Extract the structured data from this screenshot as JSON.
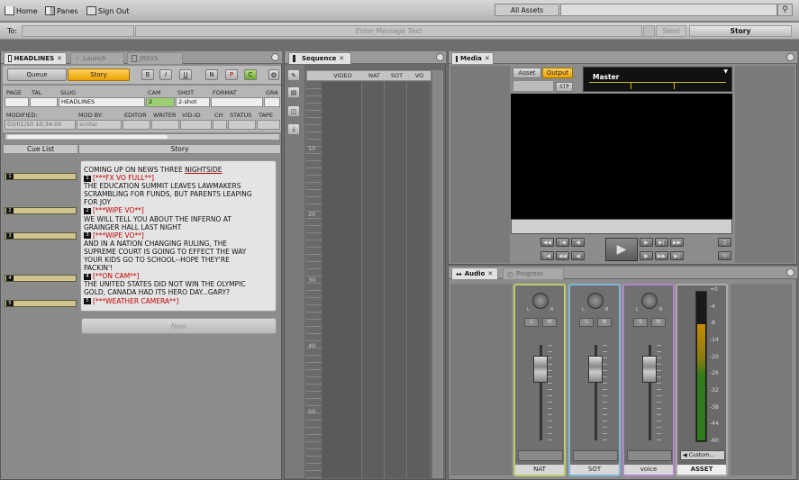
{
  "toolbar": {
    "home_label": "Home",
    "panes_label": "Panes",
    "signout_label": "Sign Out",
    "search_scope": "All Assets"
  },
  "message_bar": {
    "to_label": "To:",
    "placeholder": "Enter Message Text",
    "send_label": "Send",
    "target_value": "Story"
  },
  "left_panel": {
    "tabs": [
      {
        "label": "HEADLINES",
        "active": true
      },
      {
        "label": "Launch",
        "active": false
      },
      {
        "label": "JRSV1",
        "active": false
      }
    ],
    "mode_buttons": {
      "queue": "Queue",
      "story": "Story"
    },
    "format_buttons": [
      "B",
      "I",
      "U",
      "N",
      "P",
      "C"
    ],
    "header_labels": [
      "PAGE",
      "TAL",
      "SLUG",
      "CAM",
      "SHOT",
      "FORMAT",
      "GRA"
    ],
    "values": {
      "slug": "HEADLINES",
      "cam": "2",
      "shot": "2-shot"
    },
    "meta_labels": [
      "MODIFIED:",
      "MOD BY:",
      "EDITOR",
      "WRITER",
      "VID-ID",
      "CH",
      "STATUS",
      "TAPE"
    ],
    "meta_values": {
      "modified": "03/01/10 10:34:05",
      "mod_by": "avstar"
    },
    "columns": {
      "cue_list": "Cue List",
      "story": "Story"
    },
    "cue_numbers": [
      "1",
      "2",
      "3",
      "4",
      "5"
    ],
    "story_lines": [
      {
        "text": "COMING UP ON NEWS THREE ",
        "suffix": "NIGHTSIDE",
        "red": false,
        "num": ""
      },
      {
        "text": "[***FX VO FULL**]",
        "red": true,
        "num": "1"
      },
      {
        "text": "THE EDUCATION SUMMIT LEAVES LAWMAKERS",
        "red": false,
        "num": ""
      },
      {
        "text": "SCRAMBLING FOR FUNDS, BUT PARENTS LEAPING",
        "red": false,
        "num": ""
      },
      {
        "text": "FOR JOY",
        "red": false,
        "num": ""
      },
      {
        "text": "[***WIPE VO**]",
        "red": true,
        "num": "2"
      },
      {
        "text": "WE WILL TELL YOU ABOUT THE INFERNO AT",
        "red": false,
        "num": ""
      },
      {
        "text": "GRAINGER HALL LAST NIGHT",
        "red": false,
        "num": ""
      },
      {
        "text": "[***WIPE VO**]",
        "red": true,
        "num": "3"
      },
      {
        "text": "AND IN A NATION CHANGING RULING, THE",
        "red": false,
        "num": ""
      },
      {
        "text": "SUPREME COURT IS GOING TO EFFECT THE WAY",
        "red": false,
        "num": ""
      },
      {
        "text": "YOUR KIDS GO TO SCHOOL--HOPE THEY'RE",
        "red": false,
        "num": ""
      },
      {
        "text": "PACKIN'!",
        "red": false,
        "num": ""
      },
      {
        "text": "[**ON CAM**]",
        "red": true,
        "num": "4"
      },
      {
        "text": "THE UNITED STATES DID NOT WIN THE OLYMPIC",
        "red": false,
        "num": ""
      },
      {
        "text": "GOLD, CANADA HAD ITS HERO DAY...GARY?",
        "red": false,
        "num": ""
      },
      {
        "text": "[***WEATHER CAMERA**]",
        "red": true,
        "num": "5"
      }
    ],
    "new_button": "New"
  },
  "sequence": {
    "title": "Sequence",
    "tracks": [
      "VIDEO",
      "NAT",
      "SOT",
      "VO"
    ],
    "ruler_labels": [
      "10",
      "20",
      "30",
      "40",
      "50"
    ]
  },
  "media": {
    "title": "Media",
    "asset_label": "Asset",
    "output_label": "Output",
    "stp_label": "STP",
    "master_label": "Master"
  },
  "audio": {
    "tabs": [
      {
        "label": "Audio",
        "active": true
      },
      {
        "label": "Progress",
        "active": false
      }
    ],
    "strip_letters": {
      "l": "L",
      "r": "R",
      "s": "S",
      "m": "M"
    },
    "strips": [
      "NAT",
      "SOT",
      "voice"
    ],
    "asset_strip": "ASSET",
    "custom_label": "Custom...",
    "meter_labels": [
      "+0",
      "-4",
      "-8",
      "-14",
      "-20",
      "-26",
      "-32",
      "-38",
      "-44",
      "-60"
    ],
    "meter_level": 0.78
  },
  "colors": {
    "accent_orange": "#f0a400",
    "meter_green": "#2e7d1a",
    "meter_amber": "#c78a00",
    "cue_red": "#c40000"
  }
}
